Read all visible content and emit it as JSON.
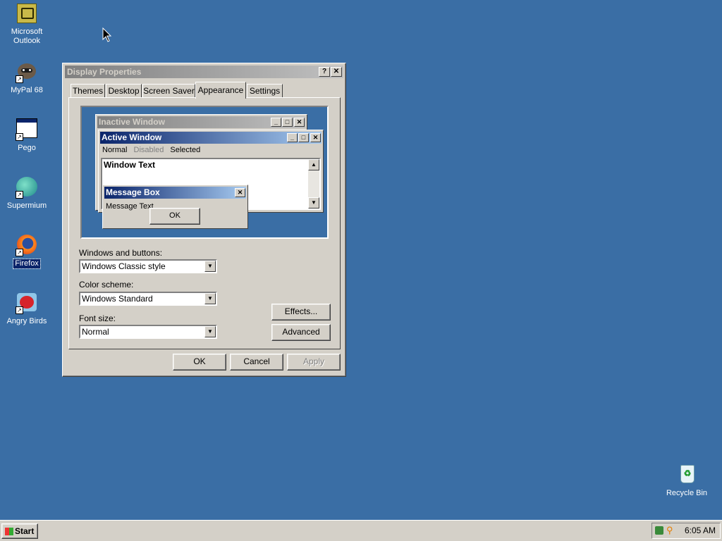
{
  "desktop": {
    "icons": [
      {
        "label": "Microsoft Outlook",
        "icon": "outlook-icon"
      },
      {
        "label": "MyPal 68",
        "icon": "mypal-icon"
      },
      {
        "label": "Pego",
        "icon": "application-icon"
      },
      {
        "label": "Supermium",
        "icon": "supermium-icon"
      },
      {
        "label": "Firefox",
        "icon": "firefox-icon"
      },
      {
        "label": "Angry Birds",
        "icon": "angry-birds-icon"
      }
    ],
    "recycle_bin": "Recycle Bin"
  },
  "dialog": {
    "title": "Display Properties",
    "help": "?",
    "close": "✕",
    "tabs": [
      "Themes",
      "Desktop",
      "Screen Saver",
      "Appearance",
      "Settings"
    ],
    "active_tab": "Appearance",
    "preview": {
      "inactive_title": "Inactive Window",
      "active_title": "Active Window",
      "menu_normal": "Normal",
      "menu_disabled": "Disabled",
      "menu_selected": "Selected",
      "window_text": "Window Text",
      "msgbox_title": "Message Box",
      "msgbox_text": "Message Text",
      "msgbox_ok": "OK"
    },
    "windows_buttons_label": "Windows and buttons:",
    "windows_buttons_value": "Windows Classic style",
    "color_scheme_label": "Color scheme:",
    "color_scheme_value": "Windows Standard",
    "font_size_label": "Font size:",
    "font_size_value": "Normal",
    "effects_button": "Effects...",
    "advanced_button": "Advanced",
    "ok_button": "OK",
    "cancel_button": "Cancel",
    "apply_button": "Apply"
  },
  "taskbar": {
    "start_label": "Start",
    "clock": "6:05 AM"
  },
  "colors": {
    "desktop": "#3a6ea5",
    "face": "#d4d0c8",
    "active_title_start": "#0a246a",
    "active_title_end": "#a6caf0",
    "inactive_title_start": "#808080",
    "inactive_title_end": "#c0c0c0"
  }
}
